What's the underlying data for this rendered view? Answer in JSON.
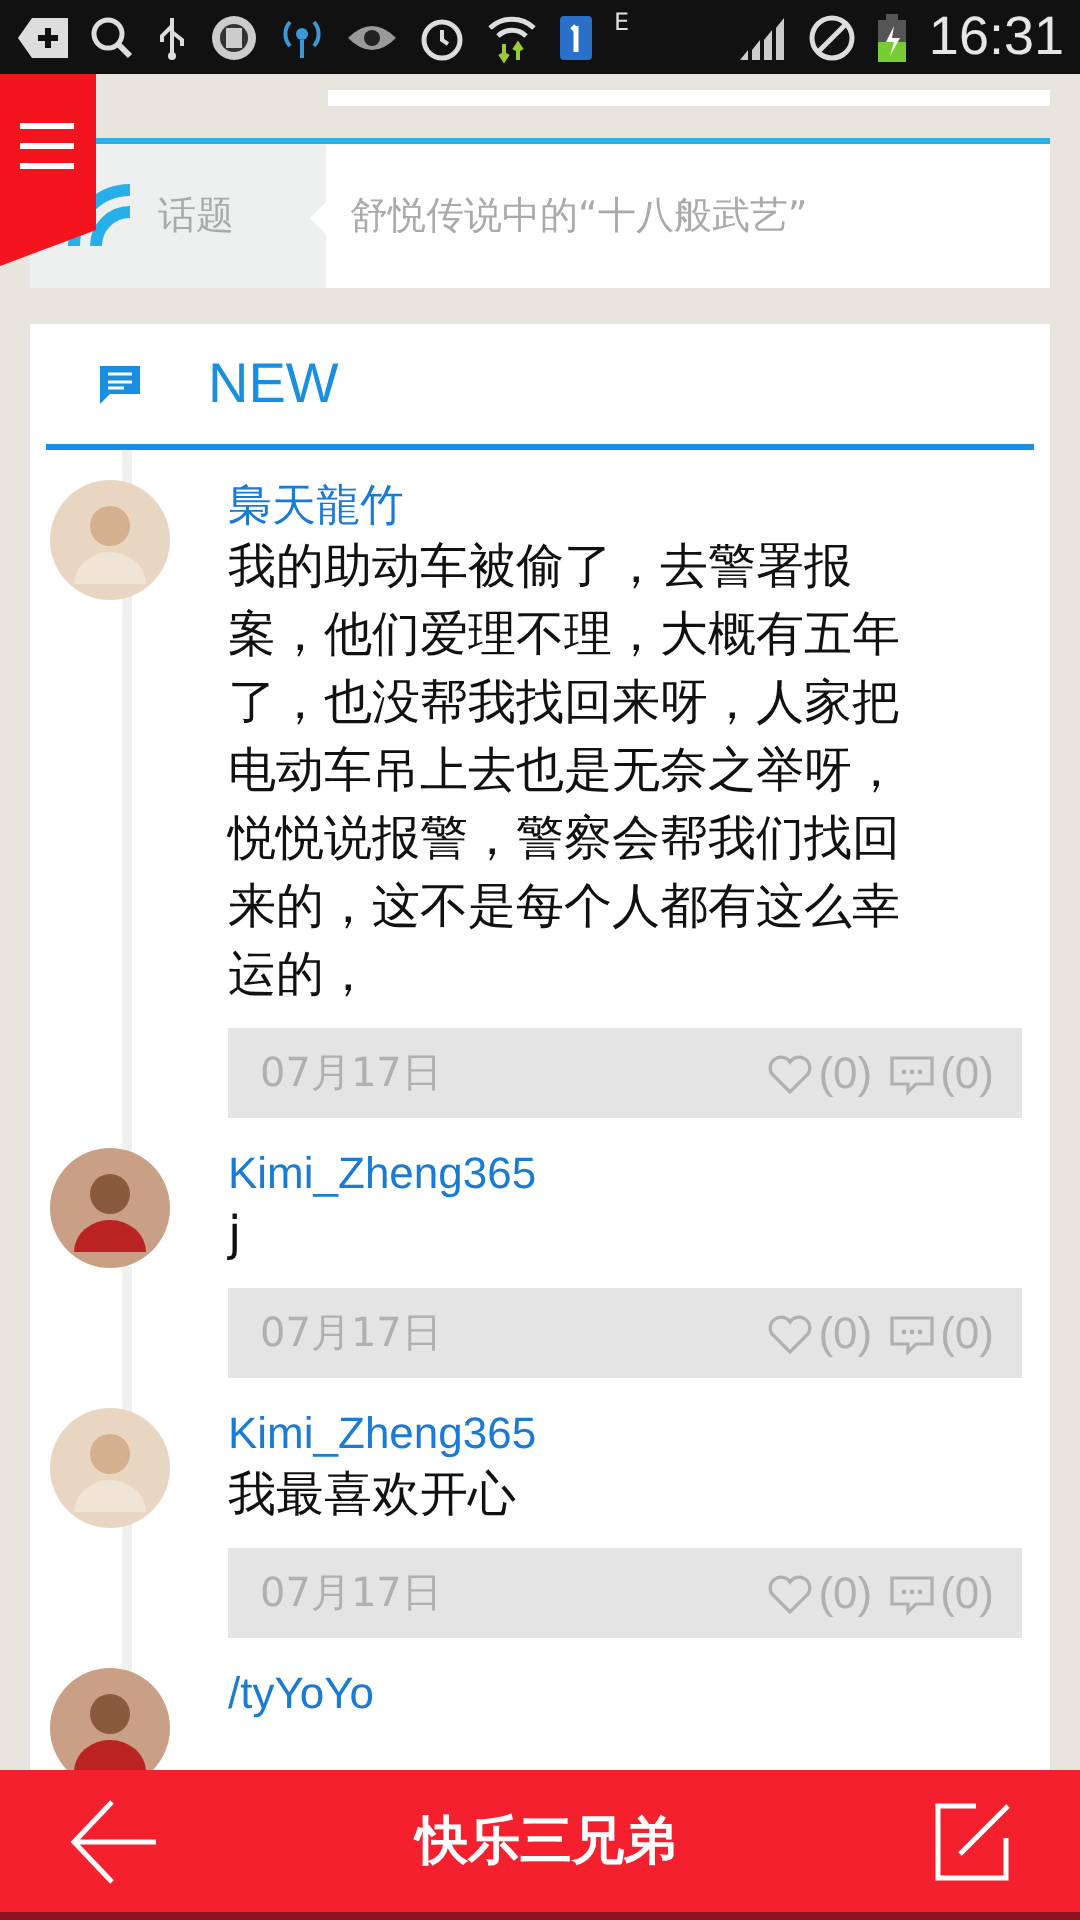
{
  "status_bar": {
    "network": "E",
    "time": "16:31"
  },
  "topic": {
    "label": "话题",
    "text": "舒悦传说中的“十八般武艺”"
  },
  "feed": {
    "heading": "NEW",
    "comments": [
      {
        "name": "梟天龍竹",
        "text": "我的助动车被偷了，去警署报案，他们爱理不理，大概有五年了，也没帮我找回来呀，人家把电动车吊上去也是无奈之举呀，悦悦说报警，警察会帮我们找回来的，这不是每个人都有这么幸运的，",
        "date": "07月17日",
        "likes": "(0)",
        "replies": "(0)"
      },
      {
        "name": "Kimi_Zheng365",
        "text": "j",
        "date": "07月17日",
        "likes": "(0)",
        "replies": "(0)"
      },
      {
        "name": "Kimi_Zheng365",
        "text": "我最喜欢开心",
        "date": "07月17日",
        "likes": "(0)",
        "replies": "(0)"
      },
      {
        "name": "/tyYoYo"
      }
    ]
  },
  "bottom_bar": {
    "title": "快乐三兄弟"
  }
}
